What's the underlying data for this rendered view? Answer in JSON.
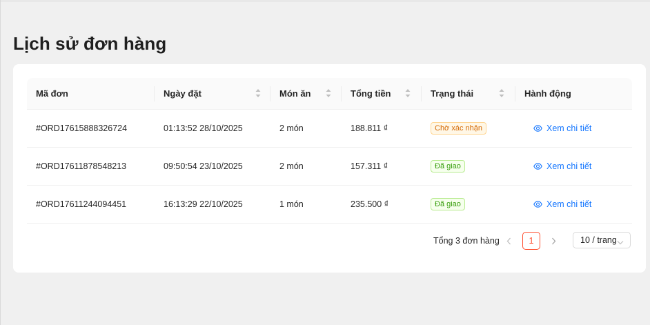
{
  "page": {
    "title": "Lịch sử đơn hàng"
  },
  "table": {
    "columns": [
      {
        "label": "Mã đơn",
        "sortable": false
      },
      {
        "label": "Ngày đặt",
        "sortable": true
      },
      {
        "label": "Món ăn",
        "sortable": true
      },
      {
        "label": "Tổng tiền",
        "sortable": true
      },
      {
        "label": "Trạng thái",
        "sortable": true
      },
      {
        "label": "Hành động",
        "sortable": false
      }
    ],
    "rows": [
      {
        "id": "#ORD17615888326724",
        "date": "01:13:52 28/10/2025",
        "items": "2 món",
        "total": "188.811 ₫",
        "status": "Chờ xác nhận",
        "status_kind": "pending",
        "action": "Xem chi tiết"
      },
      {
        "id": "#ORD17611878548213",
        "date": "09:50:54 23/10/2025",
        "items": "2 món",
        "total": "157.311 ₫",
        "status": "Đã giao",
        "status_kind": "done",
        "action": "Xem chi tiết"
      },
      {
        "id": "#ORD17611244094451",
        "date": "16:13:29 22/10/2025",
        "items": "1 món",
        "total": "235.500 ₫",
        "status": "Đã giao",
        "status_kind": "done",
        "action": "Xem chi tiết"
      }
    ]
  },
  "pagination": {
    "total_text": "Tổng 3 đơn hàng",
    "current_page": "1",
    "page_size": "10 / trang",
    "prev_icon": "chevron-left-icon",
    "next_icon": "chevron-right-icon"
  },
  "colors": {
    "accent": "#ff4d2e",
    "link": "#1677ff",
    "pending_text": "#d46b08",
    "pending_bg": "#fff7e6",
    "done_text": "#389e0d",
    "done_bg": "#f6ffed"
  }
}
